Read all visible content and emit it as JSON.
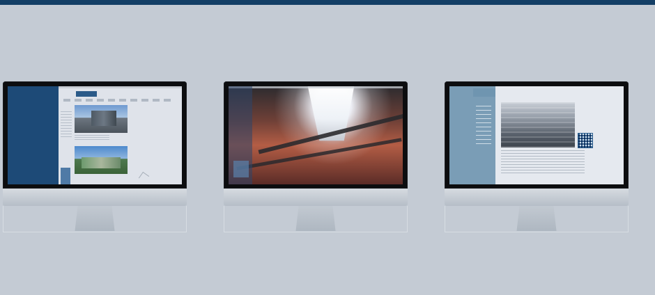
{
  "colors": {
    "background": "#c4cbd4",
    "topbar": "#143f66",
    "bezel": "#0c0d0f",
    "accent_blue": "#1d4a77",
    "steel_blue": "#7a9db6"
  },
  "icons": {
    "monitor": "desktop-monitor-icon"
  },
  "gallery": {
    "items": [
      {
        "label": ""
      },
      {
        "label": ""
      },
      {
        "label": ""
      }
    ]
  }
}
